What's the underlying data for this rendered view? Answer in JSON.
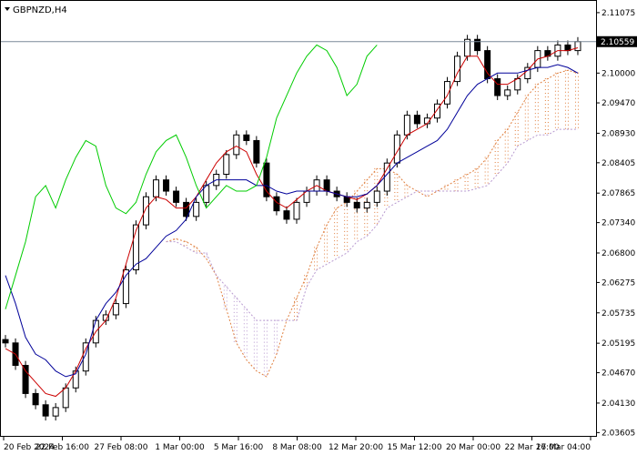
{
  "window": {
    "symbol_label": "GBPNZD,H4"
  },
  "chart_data": {
    "type": "candlestick",
    "title": "GBPNZD,H4",
    "current_price": 2.10559,
    "ylim": [
      2.0353,
      2.113
    ],
    "y_ticks": [
      "2.11075",
      "2.10000",
      "2.09470",
      "2.08930",
      "2.08405",
      "2.07865",
      "2.07340",
      "2.06800",
      "2.06275",
      "2.05735",
      "2.05195",
      "2.04670",
      "2.04130",
      "2.03605"
    ],
    "x_ticks": [
      "20 Feb 2024",
      "22 Feb 16:00",
      "27 Feb 08:00",
      "1 Mar 00:00",
      "5 Mar 16:00",
      "8 Mar 08:00",
      "12 Mar 20:00",
      "15 Mar 12:00",
      "20 Mar 00:00",
      "22 Mar 16:00",
      "27 Mar 04:00"
    ],
    "grid": false,
    "series": [
      {
        "role": "price-close",
        "values": [
          2.052,
          2.048,
          2.043,
          2.041,
          2.039,
          2.0405,
          2.044,
          2.047,
          2.052,
          2.056,
          2.057,
          2.059,
          2.065,
          2.073,
          2.078,
          2.081,
          2.079,
          2.077,
          2.0745,
          2.077,
          2.08,
          2.082,
          2.0855,
          2.089,
          2.088,
          2.084,
          2.078,
          2.0755,
          2.074,
          2.077,
          2.079,
          2.081,
          2.079,
          2.078,
          2.077,
          2.076,
          2.077,
          2.079,
          2.084,
          2.089,
          2.0925,
          2.091,
          2.092,
          2.0945,
          2.0985,
          2.103,
          2.106,
          2.104,
          2.099,
          2.096,
          2.097,
          2.099,
          2.101,
          2.104,
          2.103,
          2.105,
          2.104,
          2.1056
        ]
      },
      {
        "role": "tenkan",
        "color": "#cc0000",
        "values": [
          2.051,
          2.05,
          2.047,
          2.045,
          2.043,
          2.0425,
          2.044,
          2.047,
          2.051,
          2.054,
          2.056,
          2.06,
          2.066,
          2.072,
          2.076,
          2.078,
          2.0775,
          2.076,
          2.076,
          2.078,
          2.081,
          2.084,
          2.086,
          2.087,
          2.086,
          2.082,
          2.079,
          2.077,
          2.076,
          2.0775,
          2.079,
          2.08,
          2.079,
          2.0785,
          2.078,
          2.0775,
          2.0785,
          2.08,
          2.083,
          2.086,
          2.089,
          2.09,
          2.091,
          2.0935,
          2.096,
          2.1,
          2.103,
          2.103,
          2.1,
          2.098,
          2.098,
          2.099,
          2.1005,
          2.1025,
          2.103,
          2.104,
          2.104,
          2.1045
        ]
      },
      {
        "role": "kijun",
        "color": "#000099",
        "values": [
          2.064,
          2.059,
          2.053,
          2.05,
          2.049,
          2.047,
          2.046,
          2.0465,
          2.05,
          2.056,
          2.059,
          2.061,
          2.064,
          2.066,
          2.067,
          2.069,
          2.071,
          2.072,
          2.074,
          2.078,
          2.08,
          2.081,
          2.081,
          2.081,
          2.081,
          2.08,
          2.08,
          2.079,
          2.0785,
          2.079,
          2.079,
          2.079,
          2.079,
          2.0785,
          2.078,
          2.078,
          2.0785,
          2.08,
          2.082,
          2.084,
          2.085,
          2.086,
          2.087,
          2.088,
          2.09,
          2.093,
          2.096,
          2.098,
          2.099,
          2.1,
          2.1,
          2.1,
          2.1005,
          2.101,
          2.101,
          2.1015,
          2.101,
          2.1
        ]
      },
      {
        "role": "chikou",
        "color": "#00cc00",
        "values": [
          2.058,
          2.064,
          2.07,
          2.078,
          2.08,
          2.076,
          2.081,
          2.085,
          2.088,
          2.087,
          2.08,
          2.076,
          2.075,
          2.077,
          2.082,
          2.086,
          2.088,
          2.089,
          2.085,
          2.08,
          2.076,
          2.078,
          2.08,
          2.079,
          2.079,
          2.08,
          2.085,
          2.092,
          2.096,
          2.1,
          2.103,
          2.105,
          2.104,
          2.101,
          2.096,
          2.098,
          2.103,
          2.105
        ]
      },
      {
        "role": "senkou-span-a",
        "color": "#e08040",
        "values": [
          2.07,
          2.0705,
          2.07,
          2.069,
          2.067,
          2.064,
          2.058,
          2.052,
          2.049,
          2.047,
          2.046,
          2.05,
          2.056,
          2.06,
          2.064,
          2.069,
          2.073,
          2.076,
          2.077,
          2.079,
          2.081,
          2.083,
          2.083,
          2.082,
          2.08,
          2.079,
          2.078,
          2.079,
          2.08,
          2.081,
          2.082,
          2.083,
          2.085,
          2.088,
          2.09,
          2.093,
          2.096,
          2.098,
          2.099,
          2.1,
          2.1005,
          2.1
        ]
      },
      {
        "role": "senkou-span-b",
        "color": "#b89ad0",
        "values": [
          2.07,
          2.07,
          2.069,
          2.068,
          2.068,
          2.064,
          2.062,
          2.06,
          2.058,
          2.056,
          2.056,
          2.056,
          2.056,
          2.056,
          2.062,
          2.065,
          2.066,
          2.067,
          2.068,
          2.07,
          2.071,
          2.073,
          2.076,
          2.077,
          2.078,
          2.079,
          2.079,
          2.079,
          2.079,
          2.079,
          2.079,
          2.0795,
          2.08,
          2.082,
          2.084,
          2.087,
          2.088,
          2.089,
          2.089,
          2.09,
          2.09,
          2.09
        ]
      }
    ]
  }
}
